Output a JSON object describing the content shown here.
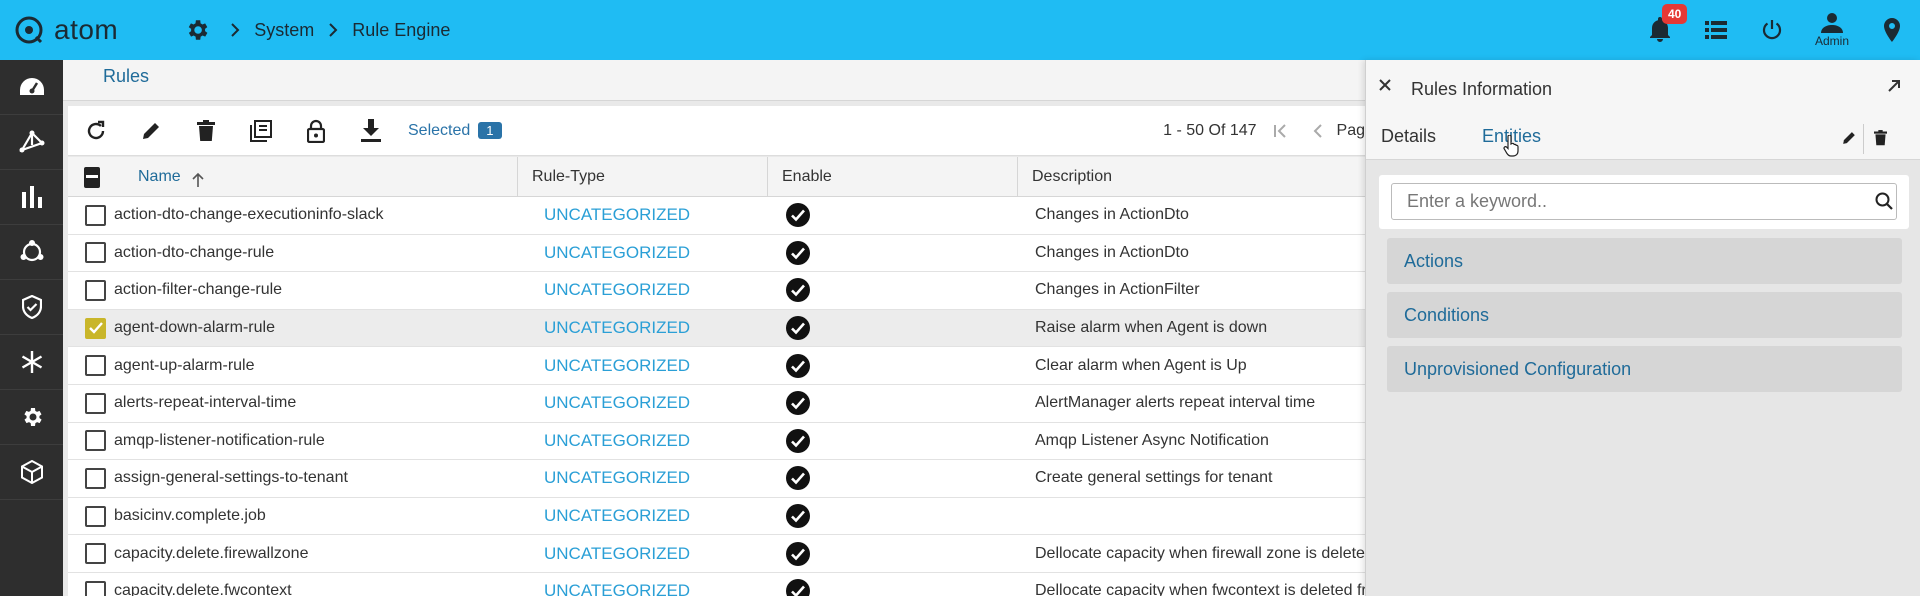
{
  "header": {
    "logo_text": "atom",
    "breadcrumbs": [
      "System",
      "Rule Engine"
    ],
    "notification_count": "40",
    "user_label": "Admin"
  },
  "sidebar": {
    "items": [
      "dashboard-icon",
      "topology-icon",
      "analytics-icon",
      "network-icon",
      "security-icon",
      "snowflake-icon",
      "settings-icon",
      "package-icon"
    ]
  },
  "page": {
    "title": "Rules"
  },
  "toolbar": {
    "selected_label": "Selected",
    "selected_count": "1",
    "pagination": "1 - 50 Of 147",
    "page_label": "Pag"
  },
  "table": {
    "columns": [
      "Name",
      "Rule-Type",
      "Enable",
      "Description"
    ],
    "rows": [
      {
        "name": "action-dto-change-executioninfo-slack",
        "type": "UNCATEGORIZED",
        "enabled": true,
        "description": "Changes in ActionDto",
        "selected": false
      },
      {
        "name": "action-dto-change-rule",
        "type": "UNCATEGORIZED",
        "enabled": true,
        "description": "Changes in ActionDto",
        "selected": false
      },
      {
        "name": "action-filter-change-rule",
        "type": "UNCATEGORIZED",
        "enabled": true,
        "description": "Changes in ActionFilter",
        "selected": false
      },
      {
        "name": "agent-down-alarm-rule",
        "type": "UNCATEGORIZED",
        "enabled": true,
        "description": "Raise alarm when Agent is down",
        "selected": true
      },
      {
        "name": "agent-up-alarm-rule",
        "type": "UNCATEGORIZED",
        "enabled": true,
        "description": "Clear alarm when Agent is Up",
        "selected": false
      },
      {
        "name": "alerts-repeat-interval-time",
        "type": "UNCATEGORIZED",
        "enabled": true,
        "description": "AlertManager alerts repeat interval time",
        "selected": false
      },
      {
        "name": "amqp-listener-notification-rule",
        "type": "UNCATEGORIZED",
        "enabled": true,
        "description": "Amqp Listener Async Notification",
        "selected": false
      },
      {
        "name": "assign-general-settings-to-tenant",
        "type": "UNCATEGORIZED",
        "enabled": true,
        "description": "Create general settings for tenant",
        "selected": false
      },
      {
        "name": "basicinv.complete.job",
        "type": "UNCATEGORIZED",
        "enabled": true,
        "description": "",
        "selected": false
      },
      {
        "name": "capacity.delete.firewallzone",
        "type": "UNCATEGORIZED",
        "enabled": true,
        "description": "Dellocate capacity when firewall zone is deleted fr",
        "selected": false
      },
      {
        "name": "capacity.delete.fwcontext",
        "type": "UNCATEGORIZED",
        "enabled": true,
        "description": "Dellocate capacity when fwcontext is deleted from",
        "selected": false
      }
    ]
  },
  "panel": {
    "title": "Rules Information",
    "tabs": [
      "Details",
      "Entities"
    ],
    "active_tab": "Entities",
    "search_placeholder": "Enter a keyword..",
    "sections": [
      "Actions",
      "Conditions",
      "Unprovisioned Configuration"
    ]
  },
  "colors": {
    "topbar": "#1fbcf3",
    "sidebar": "#2e2e2e",
    "link": "#1f6b99",
    "rule_type": "#2a9fd6",
    "checkbox_selected": "#c9b62a"
  }
}
